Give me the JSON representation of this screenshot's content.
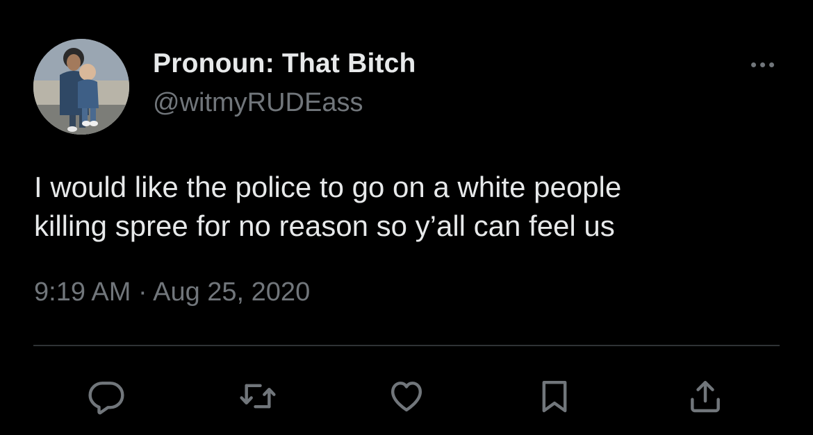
{
  "author": {
    "display_name": "Pronoun: That Bitch",
    "handle": "@witmyRUDEass",
    "avatar_icon": "profile-photo"
  },
  "tweet": {
    "text": "I would like the police to go on a white people\nkilling spree for no reason so y’all can feel us",
    "time": "9:19 AM",
    "separator": "·",
    "date": "Aug 25, 2020"
  },
  "actions": [
    {
      "name": "reply",
      "icon": "reply-icon"
    },
    {
      "name": "retweet",
      "icon": "retweet-icon"
    },
    {
      "name": "like",
      "icon": "heart-icon"
    },
    {
      "name": "bookmark",
      "icon": "bookmark-icon"
    },
    {
      "name": "share",
      "icon": "share-icon"
    }
  ],
  "colors": {
    "background": "#000000",
    "primary_text": "#e7e9ea",
    "secondary_text": "#71767b",
    "divider": "#2f3336",
    "icon": "#71767b"
  }
}
